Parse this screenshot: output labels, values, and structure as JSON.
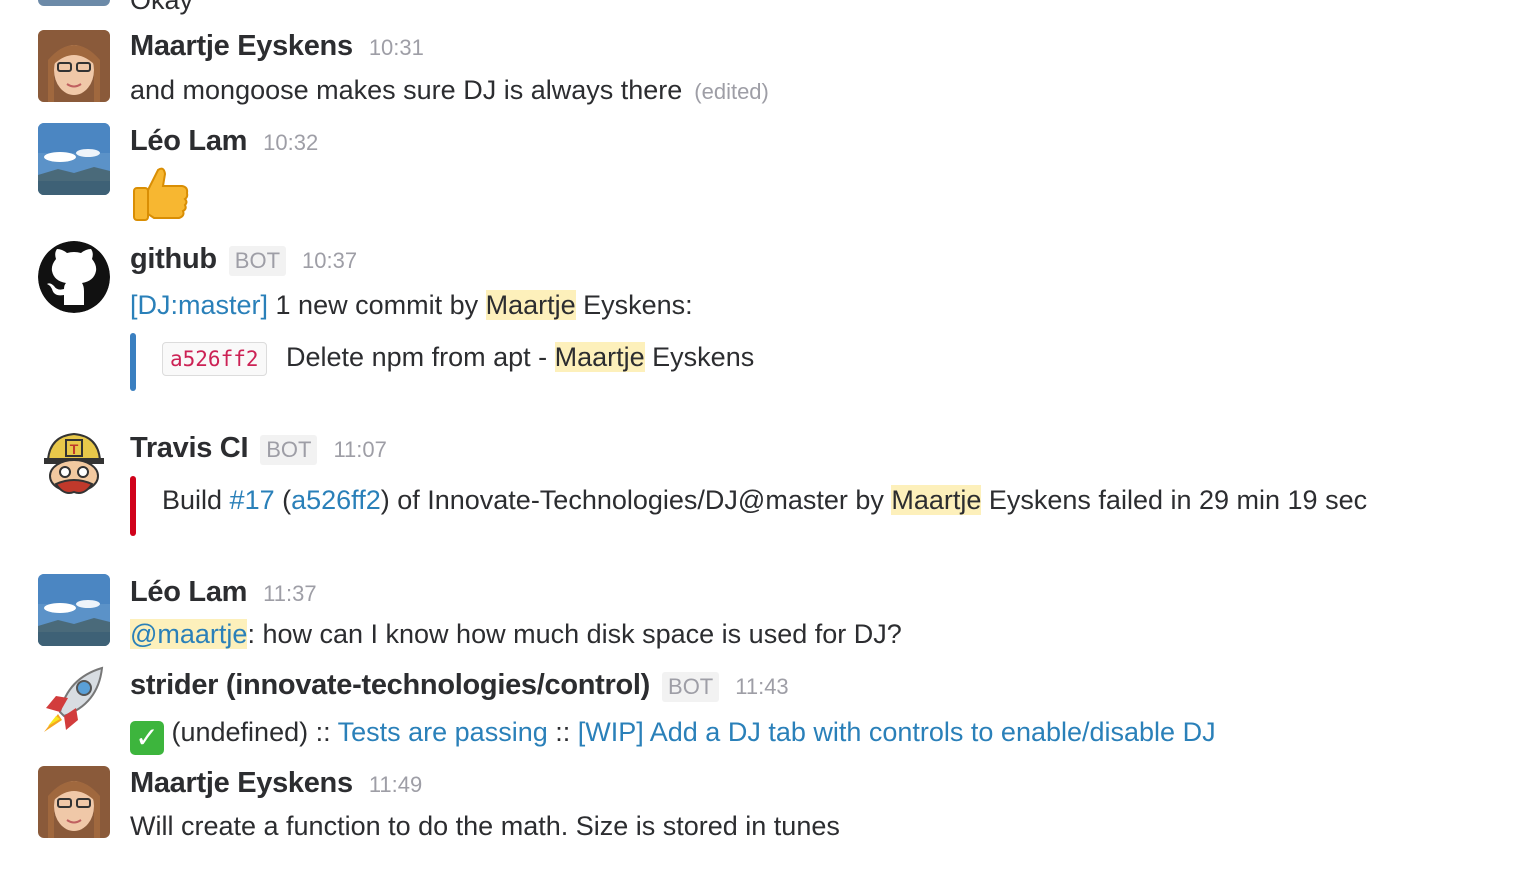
{
  "messages": {
    "partial": {
      "text": "Okay"
    },
    "m1": {
      "name": "Maartje Eyskens",
      "time": "10:31",
      "text": "and mongoose makes sure DJ is always there",
      "edited": "(edited)"
    },
    "m2": {
      "name": "Léo Lam",
      "time": "10:32",
      "emoji": "thumbs-up"
    },
    "m3": {
      "name": "github",
      "bot": "BOT",
      "time": "10:37",
      "repo_link": "[DJ:master]",
      "text_a": " 1 new commit by ",
      "author_first": "Maartje",
      "text_b": " Eyskens:",
      "commit_hash": "a526ff2",
      "commit_msg": "Delete npm from apt - ",
      "commit_author_first": "Maartje",
      "commit_author_last": " Eyskens",
      "bar_color": "#3a7fc0"
    },
    "m4": {
      "name": "Travis CI",
      "bot": "BOT",
      "time": "11:07",
      "t1": "Build ",
      "build_link": "#17",
      "t2": " (",
      "hash_link": "a526ff2",
      "t3": ") of Innovate-Technologies/DJ@master by ",
      "author_first": "Maartje",
      "t4": " Eyskens failed in 29 min 19 sec",
      "bar_color": "#d0021b"
    },
    "m5": {
      "name": "Léo Lam",
      "time": "11:37",
      "mention": "@maartje",
      "text": ": how can I know how much disk space is used for DJ?"
    },
    "m6": {
      "name": "strider (innovate-technologies/control)",
      "bot": "BOT",
      "time": "11:43",
      "check": "✓",
      "t1": " (undefined) :: ",
      "link1": "Tests are passing",
      "t2": " :: ",
      "link2": "[WIP] Add a DJ tab with controls to enable/disable DJ"
    },
    "m7": {
      "name": "Maartje Eyskens",
      "time": "11:49",
      "text": "Will create a function to do the math. Size is stored in tunes"
    }
  }
}
